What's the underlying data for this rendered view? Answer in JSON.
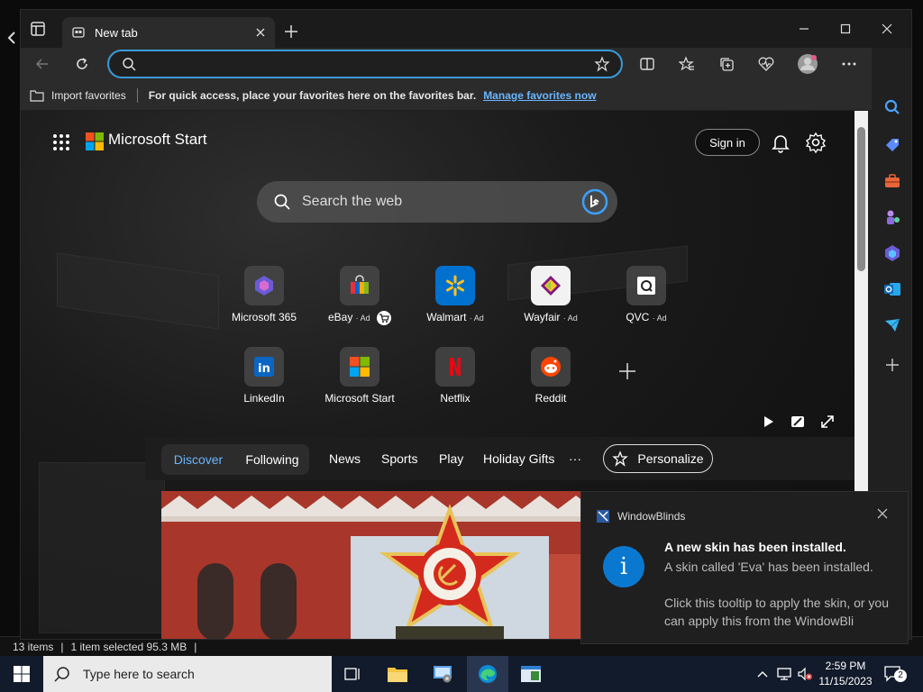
{
  "behind": {
    "status": {
      "items": "13 items",
      "selected": "1 item selected  95.3 MB"
    }
  },
  "browser": {
    "tab": {
      "title": "New tab"
    },
    "address": {
      "value": ""
    },
    "favorites_bar": {
      "import_label": "Import favorites",
      "message": "For quick access, place your favorites here on the favorites bar.",
      "manage_link": "Manage favorites now"
    }
  },
  "newtab": {
    "brand": "Microsoft Start",
    "sign_in": "Sign in",
    "search_placeholder": "Search the web",
    "tiles": [
      {
        "label": "Microsoft 365",
        "ad": ""
      },
      {
        "label": "eBay",
        "ad": "· Ad"
      },
      {
        "label": "Walmart",
        "ad": "· Ad"
      },
      {
        "label": "Wayfair",
        "ad": "· Ad"
      },
      {
        "label": "QVC",
        "ad": "· Ad"
      },
      {
        "label": "LinkedIn",
        "ad": ""
      },
      {
        "label": "Microsoft Start",
        "ad": ""
      },
      {
        "label": "Netflix",
        "ad": ""
      },
      {
        "label": "Reddit",
        "ad": ""
      }
    ],
    "feed": {
      "tabs": [
        "Discover",
        "Following"
      ],
      "items": [
        "News",
        "Sports",
        "Play",
        "Holiday Gifts"
      ],
      "more": "···",
      "personalize": "Personalize"
    }
  },
  "toast": {
    "app": "WindowBlinds",
    "title": "A new skin has been installed.",
    "body": "A skin called 'Eva' has been installed.\n\nClick this tooltip to apply the skin, or you can apply this from the WindowBli"
  },
  "taskbar": {
    "search_placeholder": "Type here to search",
    "time": "2:59 PM",
    "date": "11/15/2023",
    "notification_count": "2"
  },
  "colors": {
    "accent": "#3a9bd9",
    "link": "#6ab5ff",
    "taskbar": "#121b2b"
  }
}
